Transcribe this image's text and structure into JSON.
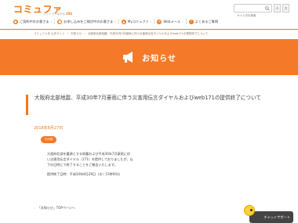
{
  "header": {
    "logo_main": "コミュファ",
    "logo_sub": "ネットでつながる",
    "logo_ctc": "ctc",
    "search_placeholder": "サイト内を検索",
    "size_small": "小",
    "size_large": "大"
  },
  "nav": {
    "items": [
      {
        "label": "ご契約中のお客さま"
      },
      {
        "label": "お申し込みをご検討中のお客さま"
      },
      {
        "label": "Myコミュファ"
      },
      {
        "label": "Webメール"
      },
      {
        "label": "よくあるご質問"
      }
    ]
  },
  "breadcrumb": {
    "items": [
      "コミュファ光 公式サイト",
      "お知らせ",
      "大阪府北部地震、平成30年7月豪雨に伴う災害用伝言ダイヤルおよびweb171の提供終了について"
    ]
  },
  "banner": {
    "title": "お知らせ"
  },
  "article": {
    "title": "大阪府北部地震、平成30年7月豪雨に伴う災害用伝言ダイヤルおよびweb171の提供終了について",
    "date": "2018年8月27日",
    "tag": "その他",
    "body": [
      "大阪府北部を震源とする地震および平成30年7月豪雨に伴い災害用伝言ダイヤル（171）を提供しておりましたが、以下の日時にて終了することをご報告いたします。",
      "提供終了日時：平成30年8月29日（水）15時00分"
    ]
  },
  "footer": {
    "back_link": "「お知らせ」TOPページへ"
  },
  "chat": {
    "label": "チャットサポート"
  },
  "colors": {
    "accent": "#ee7a1a",
    "banner": "#f47a2a"
  }
}
